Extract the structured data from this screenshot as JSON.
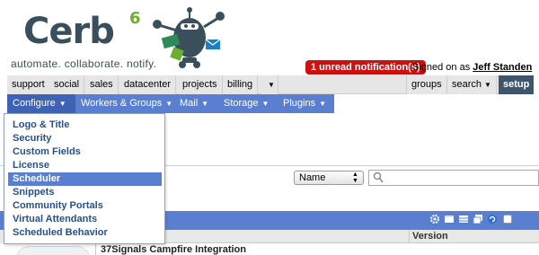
{
  "logo": {
    "word": "Cerb",
    "sup": "6",
    "tagline": "automate. collaborate. notify."
  },
  "header": {
    "notification": "1 unread notification(s)",
    "signed_in_prefix": "Signed on as",
    "user": "Jeff Standen"
  },
  "tabs": {
    "support": "support",
    "social": "social",
    "sales": "sales",
    "datacenter": "datacenter",
    "projects": "projects",
    "billing": "billing",
    "groups": "groups",
    "search": "search",
    "setup": "setup"
  },
  "menu": {
    "configure": "Configure",
    "workers": "Workers & Groups",
    "mail": "Mail",
    "storage": "Storage",
    "plugins": "Plugins"
  },
  "dropdown": {
    "items": [
      "Logo & Title",
      "Security",
      "Custom Fields",
      "License",
      "Scheduler",
      "Snippets",
      "Community Portals",
      "Virtual Attendants",
      "Scheduled Behavior"
    ],
    "selected": "Scheduler"
  },
  "search": {
    "field_selected": "Name",
    "query": ""
  },
  "worklist": {
    "column_version": "Version",
    "row1_name": "37Signals Campfire Integration"
  },
  "icons": [
    "robot-logo-icon",
    "gear-icon",
    "columns-icon",
    "table-icon",
    "copy-icon",
    "refresh-icon",
    "select-all-checkbox",
    "search-icon",
    "caret-down-icon"
  ],
  "colors": {
    "menu_blue": "#5a7fd1",
    "menu_active": "#3f63b4",
    "setup_tab": "#3e566a",
    "notification_red": "#cc1111",
    "link_blue": "#26508e",
    "logo_green": "#6cae2e"
  }
}
